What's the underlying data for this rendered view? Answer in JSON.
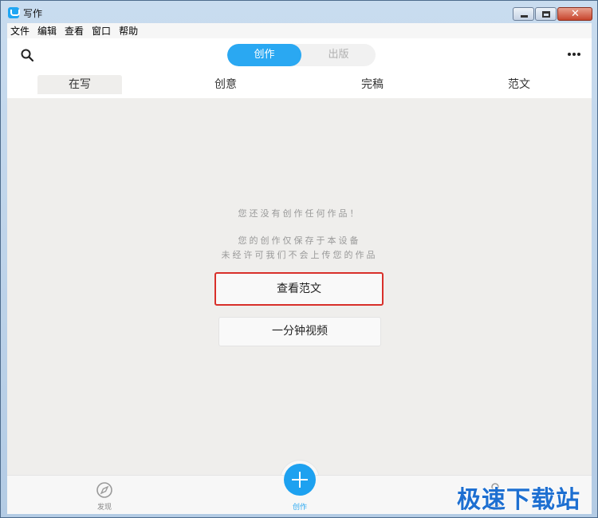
{
  "window": {
    "title": "写作"
  },
  "menu": [
    "文件",
    "编辑",
    "查看",
    "窗口",
    "帮助"
  ],
  "segments": {
    "active": "创作",
    "inactive": "出版"
  },
  "tabs": [
    "在写",
    "创意",
    "完稿",
    "范文"
  ],
  "empty_state": {
    "line1": "您还没有创作任何作品！",
    "line2": "您的创作仅保存于本设备",
    "line3": "未经许可我们不会上传您的作品"
  },
  "buttons": {
    "view_samples": "查看范文",
    "one_minute_video": "一分钟视频"
  },
  "bottom_nav": {
    "discover": "发现",
    "create": "创作",
    "mine": "我的"
  },
  "watermark": "极速下载站",
  "colors": {
    "accent": "#2aa8f2",
    "highlight_border": "#d8302a"
  }
}
